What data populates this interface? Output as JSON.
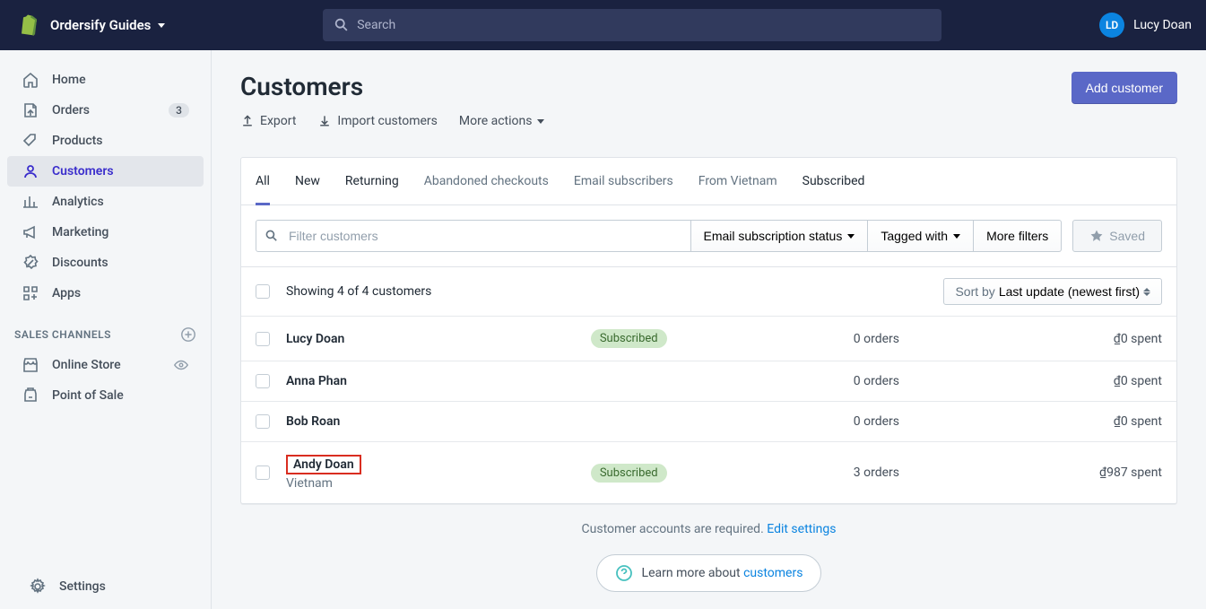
{
  "header": {
    "store_name": "Ordersify Guides",
    "search_placeholder": "Search",
    "user_initials": "LD",
    "user_name": "Lucy Doan"
  },
  "sidebar": {
    "items": [
      {
        "label": "Home"
      },
      {
        "label": "Orders",
        "badge": "3"
      },
      {
        "label": "Products"
      },
      {
        "label": "Customers"
      },
      {
        "label": "Analytics"
      },
      {
        "label": "Marketing"
      },
      {
        "label": "Discounts"
      },
      {
        "label": "Apps"
      }
    ],
    "channels_title": "SALES CHANNELS",
    "channels": [
      {
        "label": "Online Store"
      },
      {
        "label": "Point of Sale"
      }
    ],
    "settings": "Settings"
  },
  "page": {
    "title": "Customers",
    "add_button": "Add customer",
    "export": "Export",
    "import": "Import customers",
    "more_actions": "More actions"
  },
  "tabs": [
    "All",
    "New",
    "Returning",
    "Abandoned checkouts",
    "Email subscribers",
    "From Vietnam",
    "Subscribed"
  ],
  "filters": {
    "placeholder": "Filter customers",
    "email_status": "Email subscription status",
    "tagged": "Tagged with",
    "more": "More filters",
    "saved": "Saved"
  },
  "list": {
    "showing": "Showing 4 of 4 customers",
    "sort_prefix": "Sort by ",
    "sort_value": "Last update (newest first)"
  },
  "rows": [
    {
      "name": "Lucy Doan",
      "location": "",
      "subscribed": true,
      "orders": "0 orders",
      "spent": "₫0 spent",
      "highlighted": false
    },
    {
      "name": "Anna Phan",
      "location": "",
      "subscribed": false,
      "orders": "0 orders",
      "spent": "₫0 spent",
      "highlighted": false
    },
    {
      "name": "Bob Roan",
      "location": "",
      "subscribed": false,
      "orders": "0 orders",
      "spent": "₫0 spent",
      "highlighted": false
    },
    {
      "name": "Andy Doan",
      "location": "Vietnam",
      "subscribed": true,
      "orders": "3 orders",
      "spent": "₫987 spent",
      "highlighted": true
    }
  ],
  "subscribed_label": "Subscribed",
  "footer": {
    "text": "Customer accounts are required. ",
    "link": "Edit settings",
    "learn_prefix": "Learn more about ",
    "learn_link": "customers"
  }
}
